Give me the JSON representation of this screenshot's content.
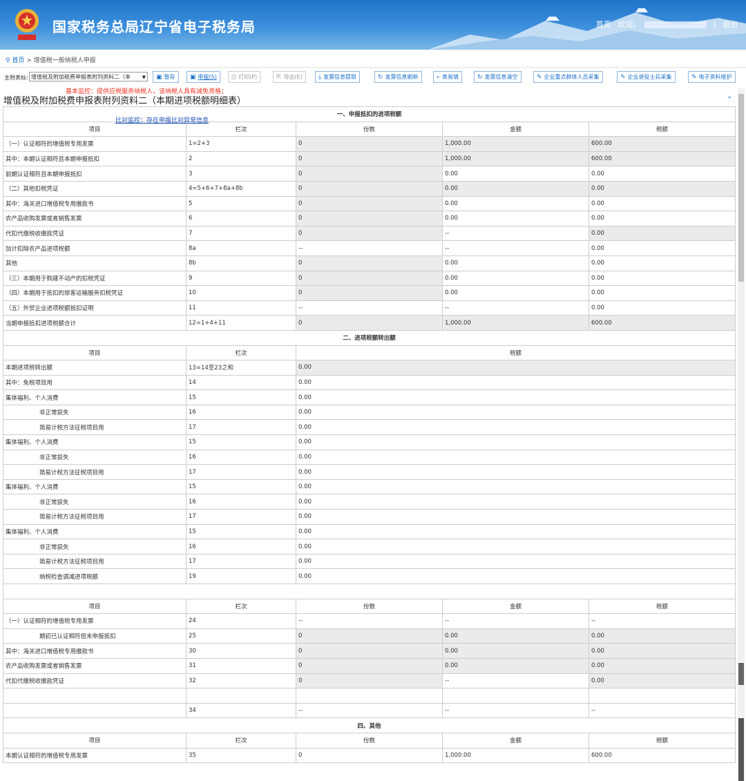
{
  "header": {
    "site_title": "国家税务总局辽宁省电子税务局",
    "home": "首页",
    "welcome": "欢迎，",
    "sep": "|",
    "logout": "退出",
    "bg_color": "#2f82d4"
  },
  "breadcrumb": {
    "home": "首页",
    "sep": ">",
    "current": "增值税一般纳税人申报"
  },
  "toolbar": {
    "label": "主附表标:",
    "select_value": "增值税及附加税费申报表附列资料二（本",
    "buttons": [
      "暂存",
      "申报(S)",
      "打印(P)",
      "导出(E)",
      "发票信息提取",
      "发票信息刷新",
      "表易填",
      "发票信息清空",
      "企业重点群体人员采集",
      "企业退役士兵采集",
      "电子资料维护"
    ]
  },
  "warning": "基本监控：提供应税服务纳税人，该纳税人具有减免资格；",
  "page_title": "增值税及附加税费申报表附列资料二（本期进项税额明细表）",
  "compare_link": "比对监控：存在申报比对异常信息",
  "section1": {
    "title": "一、申报抵扣的进项税额",
    "headers": [
      "项目",
      "栏次",
      "份数",
      "金额",
      "税额"
    ],
    "rows": [
      [
        "（一）认证相符的增值税专用发票",
        "1=2+3",
        "0",
        "1,000.00",
        "600.00"
      ],
      [
        "其中：本期认证相符且本期申报抵扣",
        "2",
        "0",
        "1,000.00",
        "600.00"
      ],
      [
        "前期认证相符且本期申报抵扣",
        "3",
        "0",
        "0.00",
        "0.00"
      ],
      [
        "（二）其他扣税凭证",
        "4=5+6+7+8a+8b",
        "0",
        "0.00",
        "0.00"
      ],
      [
        "其中：海关进口增值税专用缴款书",
        "5",
        "0",
        "0.00",
        "0.00"
      ],
      [
        "农产品收购发票或者销售发票",
        "6",
        "0",
        "0.00",
        "0.00"
      ],
      [
        "代扣代缴税收缴款凭证",
        "7",
        "0",
        "--",
        "0.00"
      ],
      [
        "加计扣除农产品进项税额",
        "8a",
        "--",
        "--",
        "0.00"
      ],
      [
        "其他",
        "8b",
        "0",
        "0.00",
        "0.00"
      ],
      [
        "（三）本期用于购建不动产的扣税凭证",
        "9",
        "0",
        "0.00",
        "0.00"
      ],
      [
        "（四）本期用于抵扣的旅客运输服务扣税凭证",
        "10",
        "0",
        "0.00",
        "0.00"
      ],
      [
        "（五）外贸企业进项税额抵扣证明",
        "11",
        "--",
        "--",
        "0.00"
      ],
      [
        "当期申报抵扣进项税额合计",
        "12=1+4+11",
        "0",
        "1,000.00",
        "600.00"
      ]
    ]
  },
  "section2": {
    "title": "二、进项税额转出额",
    "headers": [
      "项目",
      "栏次",
      "税额"
    ],
    "rows": [
      [
        "本期进项税转出额",
        "13=14至23之和",
        "0.00"
      ],
      [
        "其中：免税项目用",
        "14",
        "0.00"
      ],
      [
        "集体福利、个人消费",
        "15",
        "0.00"
      ],
      [
        "非正常损失",
        "16",
        "0.00"
      ],
      [
        "简易计税方法征税项目用",
        "17",
        "0.00"
      ],
      [
        "集体福利、个人消费",
        "15",
        "0.00"
      ],
      [
        "非正常损失",
        "16",
        "0.00"
      ],
      [
        "简易计税方法征税项目用",
        "17",
        "0.00"
      ],
      [
        "集体福利、个人消费",
        "15",
        "0.00"
      ],
      [
        "非正常损失",
        "16",
        "0.00"
      ],
      [
        "简易计税方法征税项目用",
        "17",
        "0.00"
      ],
      [
        "集体福利、个人消费",
        "15",
        "0.00"
      ],
      [
        "非正常损失",
        "16",
        "0.00"
      ],
      [
        "简易计税方法征税项目用",
        "17",
        "0.00"
      ],
      [
        "纳税检查调减进项税额",
        "19",
        "0.00"
      ]
    ]
  },
  "section3": {
    "headers": [
      "项目",
      "栏次",
      "份数",
      "金额",
      "税额"
    ],
    "rows": [
      [
        "（一）认证相符的增值税专用发票",
        "24",
        "--",
        "--",
        "--"
      ],
      [
        "期初已认证相符但未申报抵扣",
        "25",
        "0",
        "0.00",
        "0.00"
      ],
      [
        "其中：海关进口增值税专用缴款书",
        "30",
        "0",
        "0.00",
        "0.00"
      ],
      [
        "农产品收购发票或者销售发票",
        "31",
        "0",
        "0.00",
        "0.00"
      ],
      [
        "代扣代缴税收缴款凭证",
        "32",
        "0",
        "--",
        "0.00"
      ],
      [
        "",
        "",
        "",
        "",
        ""
      ],
      [
        "",
        "34",
        "--",
        "--",
        "--"
      ]
    ]
  },
  "section4": {
    "title": "四、其他",
    "headers": [
      "项目",
      "栏次",
      "份数",
      "金额",
      "税额"
    ],
    "rows": [
      [
        "本期认证相符的增值税专用发票",
        "35",
        "0",
        "1,000.00",
        "600.00"
      ]
    ]
  }
}
